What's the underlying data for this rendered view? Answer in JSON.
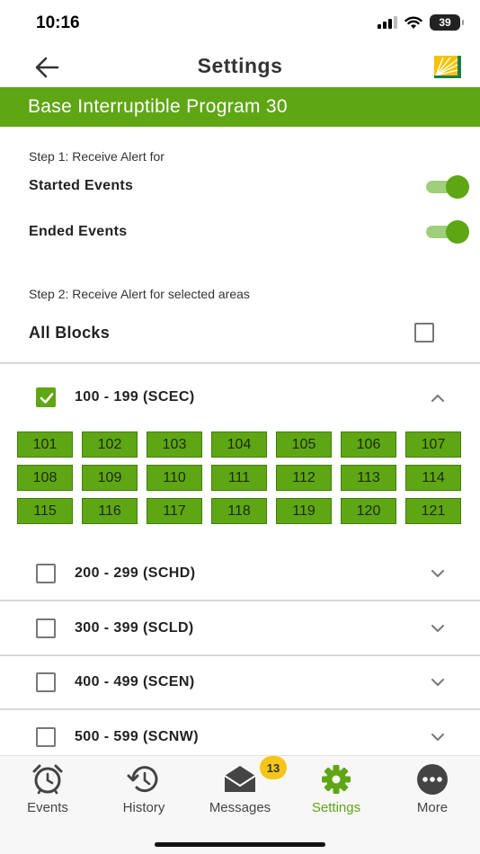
{
  "status_bar": {
    "time": "10:16",
    "battery": "39"
  },
  "nav": {
    "title": "Settings"
  },
  "program": {
    "title": "Base Interruptible Program 30"
  },
  "step1": {
    "label": "Step 1: Receive Alert for",
    "started_label": "Started Events",
    "started_on": true,
    "ended_label": "Ended Events",
    "ended_on": true
  },
  "step2": {
    "label": "Step 2: Receive Alert for selected areas",
    "all_blocks_label": "All Blocks",
    "all_blocks_checked": false
  },
  "groups": [
    {
      "label": "100 - 199 (SCEC)",
      "checked": true,
      "expanded": true
    },
    {
      "label": "200 - 299 (SCHD)",
      "checked": false,
      "expanded": false
    },
    {
      "label": "300 - 399 (SCLD)",
      "checked": false,
      "expanded": false
    },
    {
      "label": "400 - 499 (SCEN)",
      "checked": false,
      "expanded": false
    },
    {
      "label": "500 - 599 (SCNW)",
      "checked": false,
      "expanded": false
    }
  ],
  "blocks": [
    "101",
    "102",
    "103",
    "104",
    "105",
    "106",
    "107",
    "108",
    "109",
    "110",
    "111",
    "112",
    "113",
    "114",
    "115",
    "116",
    "117",
    "118",
    "119",
    "120",
    "121"
  ],
  "tabs": [
    {
      "label": "Events",
      "icon": "alarm-clock-icon",
      "active": false
    },
    {
      "label": "History",
      "icon": "history-icon",
      "active": false
    },
    {
      "label": "Messages",
      "icon": "envelope-icon",
      "active": false
    },
    {
      "label": "Settings",
      "icon": "gear-icon",
      "active": true
    },
    {
      "label": "More",
      "icon": "more-dots-icon",
      "active": false
    }
  ],
  "messages_badge": "13",
  "colors": {
    "accent": "#5fa614",
    "toggle_track": "#9fcf7a",
    "badge": "#f5c518"
  }
}
